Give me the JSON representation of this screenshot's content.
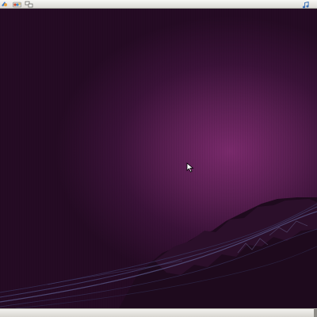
{
  "top_panel": {
    "launchers": [
      {
        "icon": "browser-icon"
      },
      {
        "icon": "palette-icon"
      },
      {
        "icon": "network-icon"
      }
    ],
    "tray": [
      {
        "icon": "music-note-icon"
      }
    ]
  },
  "desktop": {
    "wallpaper": "purple-gradient-with-mountain-curves",
    "accent": "#7a2a6c"
  },
  "bottom_panel": {}
}
